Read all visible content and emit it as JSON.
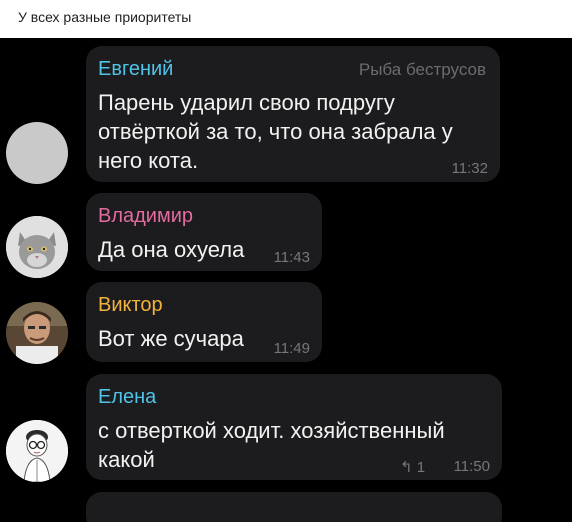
{
  "caption": "У всех разные приоритеты",
  "messages": [
    {
      "name": "Евгений",
      "forward": "Рыба беструсов",
      "text": "Парень ударил свою подругу\nотвёрткой за то, что она забрала у\nнего кота.",
      "time": "11:32",
      "color": "#4fc3e8",
      "avatar": "grey-placeholder-avatar"
    },
    {
      "name": "Владимир",
      "text": "Да она охуела",
      "time": "11:43",
      "color": "#e46ba0",
      "avatar": "cat-avatar"
    },
    {
      "name": "Виктор",
      "text": "Вот же сучара",
      "time": "11:49",
      "color": "#f2b33d",
      "avatar": "man-photo-avatar"
    },
    {
      "name": "Елена",
      "text": "с отверткой ходит. хозяйственный\nкакой",
      "time": "11:50",
      "replies": "1",
      "color": "#4fc3e8",
      "avatar": "girl-drawing-avatar"
    }
  ]
}
